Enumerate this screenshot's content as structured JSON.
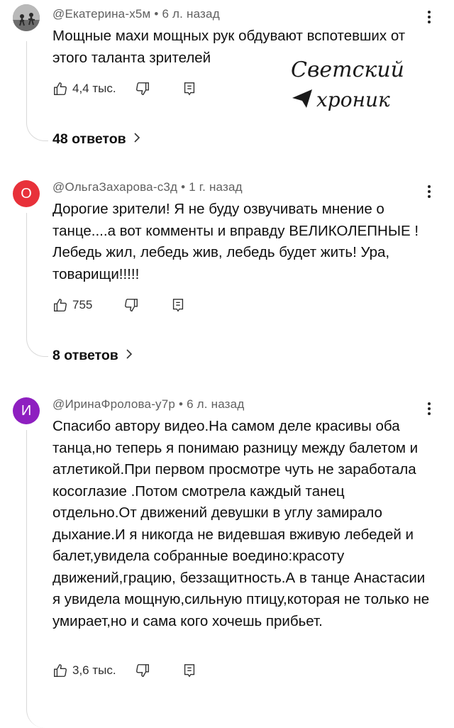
{
  "comments": [
    {
      "author": "@Екатерина-х5м",
      "time": "6 л. назад",
      "text": "Мощные махи мощных рук обдувают вспотевших от этого таланта зрителей",
      "likes": "4,4 тыс.",
      "replies_label": "48 ответов",
      "avatar_letter": "",
      "avatar_color": "#8a8a8a"
    },
    {
      "author": "@ОльгаЗахарова-с3д",
      "time": "1 г. назад",
      "text": "Дорогие зрители!  Я не буду озвучивать мнение о танце....а вот комменты и вправду ВЕЛИКОЛЕПНЫЕ ! Лебедь жил, лебедь жив, лебедь будет жить! Ура, товарищи!!!!!",
      "likes": "755",
      "replies_label": "8 ответов",
      "avatar_letter": "О",
      "avatar_color": "#e8313a"
    },
    {
      "author": "@ИринаФролова-у7р",
      "time": "6 л. назад",
      "text": "Спасибо автору видео.На самом деле красивы оба танца,но теперь я понимаю разницу между балетом и атлетикой.При первом просмотре чуть не заработала косоглазие .Потом смотрела каждый танец отдельно.От движений девушки в углу замирало дыхание.И я никогда не видевшая вживую лебедей и балет,увидела собранные воедино:красоту движений,грацию, беззащитность.А в танце Анастасии я увидела мощную,сильную птицу,которая не только не умирает,но и сама кого хочешь прибьет.",
      "likes": "3,6 тыс.",
      "avatar_letter": "И",
      "avatar_color": "#8e1fc0"
    }
  ],
  "watermark": {
    "line1": "Светский",
    "line2": "хроник"
  },
  "icons": {
    "like": "thumb-up-icon",
    "dislike": "thumb-down-icon",
    "reply": "reply-comment-icon",
    "more": "more-vertical-icon",
    "chevron": "chevron-right-icon"
  }
}
